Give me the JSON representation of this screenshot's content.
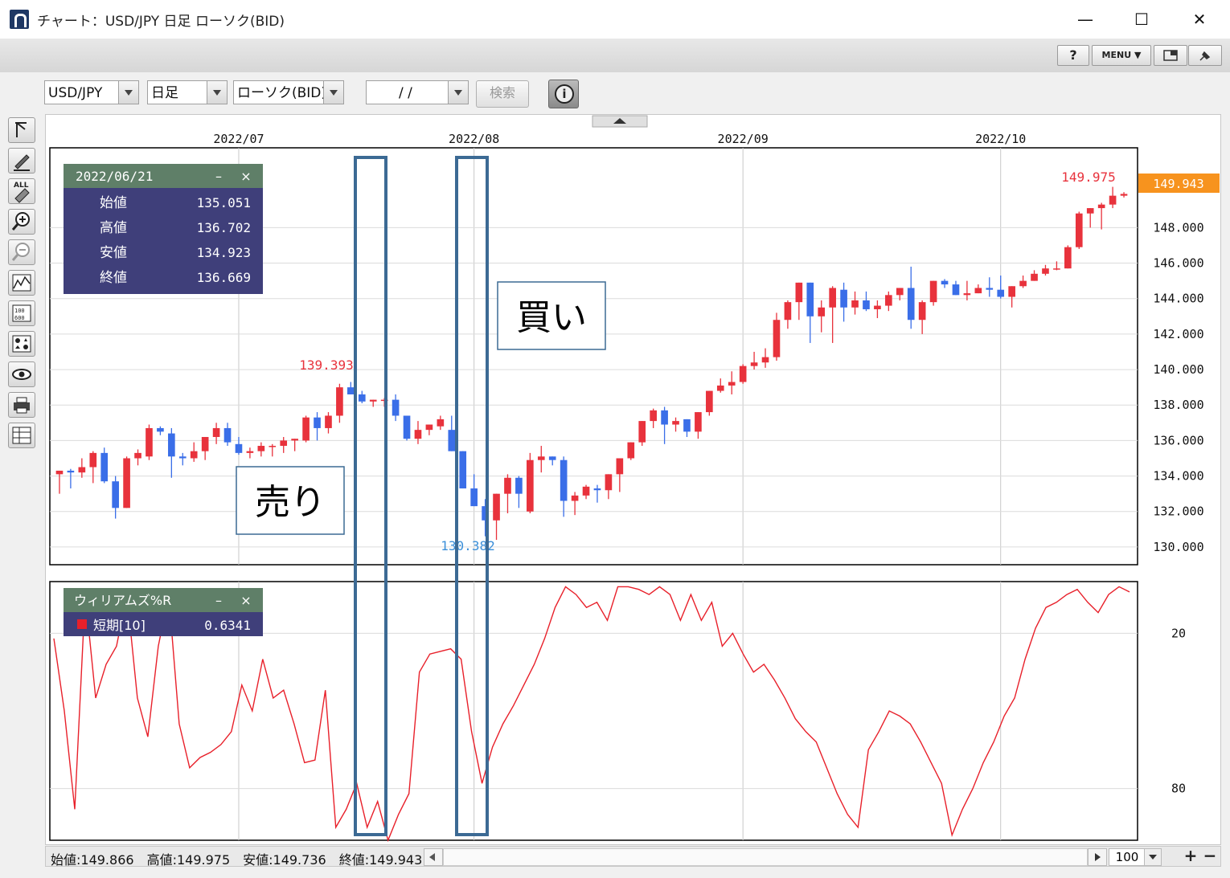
{
  "window": {
    "title": "チャート：USD/JPY 日足 ローソク(BID)",
    "minimize": "—",
    "maximize": "☐",
    "close": "✕"
  },
  "toolbar": {
    "help": "?",
    "menu": "MENU ▼",
    "layout_icon": "window-icon",
    "pin_icon": "pin-icon"
  },
  "controls": {
    "pair": "USD/JPY",
    "period": "日足",
    "chart_type": "ローソク(BID)",
    "date": "/ /",
    "search": "検索",
    "info_icon": "info-icon"
  },
  "sidebar_icons": [
    "cursor-icon",
    "pencil-icon",
    "eraser-all-icon",
    "zoom-in-icon",
    "zoom-out-icon",
    "indicator-icon",
    "numeric-icon",
    "symbols-icon",
    "eye-icon",
    "print-icon",
    "table-icon"
  ],
  "sidebar_all_label": "ALL",
  "chart_data": {
    "type": "candlestick",
    "title": "USD/JPY 日足 ローソク(BID)",
    "x_labels": [
      "2022/07",
      "2022/08",
      "2022/09",
      "2022/10"
    ],
    "y_ticks": [
      130,
      132,
      134,
      136,
      138,
      140,
      142,
      144,
      146,
      148
    ],
    "y_tick_labels": [
      "130.000",
      "132.000",
      "134.000",
      "136.000",
      "138.000",
      "140.000",
      "142.000",
      "144.000",
      "146.000",
      "148.000"
    ],
    "ylim": [
      129,
      152.5
    ],
    "current_price": "149.943",
    "high_label": "149.975",
    "peak_label": "139.393",
    "low_label": "130.382",
    "candles": [
      [
        134.1,
        134.2,
        133.0,
        134.3
      ],
      [
        134.3,
        134.4,
        133.3,
        134.2
      ],
      [
        134.2,
        135.0,
        133.9,
        134.5
      ],
      [
        134.5,
        135.4,
        133.6,
        135.3
      ],
      [
        135.3,
        135.6,
        133.6,
        133.7
      ],
      [
        133.7,
        134.0,
        131.6,
        132.2
      ],
      [
        132.2,
        135.1,
        132.3,
        135.0
      ],
      [
        135.0,
        135.5,
        134.6,
        135.3
      ],
      [
        135.1,
        136.9,
        134.9,
        136.7
      ],
      [
        136.7,
        136.8,
        136.3,
        136.5
      ],
      [
        136.4,
        136.7,
        133.9,
        135.1
      ],
      [
        135.1,
        135.3,
        134.6,
        135.0
      ],
      [
        135.0,
        135.9,
        134.8,
        135.4
      ],
      [
        135.4,
        136.1,
        134.9,
        136.2
      ],
      [
        136.2,
        137.0,
        135.8,
        136.7
      ],
      [
        136.7,
        137.0,
        135.7,
        135.9
      ],
      [
        135.8,
        136.2,
        135.2,
        135.3
      ],
      [
        135.3,
        135.6,
        135.0,
        135.4
      ],
      [
        135.4,
        135.9,
        135.1,
        135.7
      ],
      [
        135.7,
        135.8,
        135.1,
        135.7
      ],
      [
        135.7,
        136.2,
        135.3,
        136.0
      ],
      [
        136.0,
        136.1,
        135.4,
        136.1
      ],
      [
        136.0,
        137.4,
        135.9,
        137.3
      ],
      [
        137.3,
        137.6,
        136.0,
        136.7
      ],
      [
        136.7,
        137.6,
        136.4,
        137.4
      ],
      [
        137.4,
        139.2,
        137.0,
        139.0
      ],
      [
        139.0,
        139.3,
        138.7,
        138.6
      ],
      [
        138.6,
        138.8,
        138.1,
        138.2
      ],
      [
        138.2,
        138.2,
        137.9,
        138.3
      ],
      [
        138.3,
        138.4,
        137.9,
        138.3
      ],
      [
        138.3,
        138.6,
        137.1,
        137.4
      ],
      [
        137.4,
        137.4,
        136.0,
        136.1
      ],
      [
        136.1,
        137.1,
        135.8,
        136.6
      ],
      [
        136.6,
        136.9,
        136.3,
        136.9
      ],
      [
        136.8,
        137.4,
        136.6,
        137.2
      ],
      [
        136.6,
        137.4,
        135.5,
        135.4
      ],
      [
        135.4,
        134.5,
        133.5,
        133.3
      ],
      [
        133.3,
        134.1,
        132.6,
        132.3
      ],
      [
        132.3,
        132.7,
        130.6,
        131.5
      ],
      [
        131.5,
        132.3,
        130.4,
        133.0
      ],
      [
        133.0,
        134.1,
        131.9,
        133.9
      ],
      [
        133.9,
        134.0,
        132.2,
        133.0
      ],
      [
        132.0,
        135.3,
        131.9,
        134.9
      ],
      [
        134.9,
        135.7,
        134.2,
        135.1
      ],
      [
        135.1,
        135.1,
        134.6,
        134.9
      ],
      [
        134.9,
        135.1,
        131.7,
        132.6
      ],
      [
        132.6,
        133.1,
        131.8,
        132.9
      ],
      [
        132.9,
        133.5,
        132.7,
        133.4
      ],
      [
        133.3,
        133.5,
        132.5,
        133.2
      ],
      [
        133.2,
        134.0,
        132.7,
        134.1
      ],
      [
        134.1,
        135.0,
        133.1,
        135.0
      ],
      [
        135.0,
        135.7,
        134.9,
        135.9
      ],
      [
        135.9,
        137.0,
        135.7,
        137.1
      ],
      [
        137.1,
        137.8,
        136.7,
        137.7
      ],
      [
        137.7,
        137.9,
        135.8,
        136.9
      ],
      [
        136.9,
        137.3,
        136.5,
        137.1
      ],
      [
        137.2,
        137.1,
        136.2,
        136.5
      ],
      [
        136.5,
        137.6,
        136.1,
        137.6
      ],
      [
        137.6,
        138.8,
        137.4,
        138.8
      ],
      [
        138.8,
        139.5,
        138.7,
        139.1
      ],
      [
        139.1,
        139.9,
        138.6,
        139.3
      ],
      [
        139.3,
        140.3,
        139.2,
        140.2
      ],
      [
        140.2,
        141.0,
        140.0,
        140.4
      ],
      [
        140.4,
        141.2,
        140.1,
        140.7
      ],
      [
        140.7,
        143.2,
        140.5,
        142.8
      ],
      [
        142.8,
        143.9,
        142.3,
        143.8
      ],
      [
        143.8,
        144.9,
        142.8,
        144.9
      ],
      [
        144.9,
        144.9,
        141.5,
        143.0
      ],
      [
        143.0,
        143.9,
        142.1,
        143.5
      ],
      [
        143.5,
        144.7,
        141.5,
        144.6
      ],
      [
        144.5,
        144.9,
        142.7,
        143.5
      ],
      [
        143.5,
        144.4,
        143.1,
        143.9
      ],
      [
        143.9,
        144.4,
        143.3,
        143.4
      ],
      [
        143.4,
        143.9,
        142.9,
        143.6
      ],
      [
        143.6,
        144.4,
        143.3,
        144.2
      ],
      [
        144.2,
        144.6,
        143.9,
        144.6
      ],
      [
        144.6,
        145.8,
        142.3,
        142.8
      ],
      [
        142.8,
        143.9,
        142.0,
        143.8
      ],
      [
        143.8,
        144.8,
        143.6,
        145.0
      ],
      [
        145.0,
        145.1,
        144.6,
        144.8
      ],
      [
        144.8,
        145.0,
        144.2,
        144.2
      ],
      [
        144.2,
        145.0,
        143.9,
        144.3
      ],
      [
        144.3,
        144.8,
        144.3,
        144.6
      ],
      [
        144.6,
        145.2,
        144.1,
        144.5
      ],
      [
        144.5,
        145.3,
        144.0,
        144.1
      ],
      [
        144.1,
        144.7,
        143.5,
        144.7
      ],
      [
        144.7,
        145.3,
        144.6,
        145.0
      ],
      [
        145.0,
        145.6,
        145.0,
        145.4
      ],
      [
        145.4,
        145.9,
        145.3,
        145.7
      ],
      [
        145.7,
        146.1,
        145.6,
        145.7
      ],
      [
        145.7,
        147.0,
        145.7,
        146.9
      ],
      [
        146.9,
        148.9,
        146.8,
        148.8
      ],
      [
        148.8,
        149.1,
        148.0,
        149.1
      ],
      [
        149.1,
        149.4,
        147.9,
        149.3
      ],
      [
        149.3,
        150.3,
        149.1,
        149.8
      ],
      [
        149.8,
        150.0,
        149.7,
        149.9
      ]
    ],
    "williams_r": [
      -22,
      -50,
      -88,
      -5,
      -45,
      -32,
      -25,
      -5,
      -45,
      -60,
      -25,
      -5,
      -55,
      -72,
      -68,
      -66,
      -63,
      -58,
      -40,
      -50,
      -30,
      -45,
      -42,
      -55,
      -70,
      -69,
      -42,
      -95,
      -88,
      -78,
      -95,
      -85,
      -100,
      -90,
      -82,
      -35,
      -28,
      -27,
      -26,
      -30,
      -58,
      -78,
      -64,
      -55,
      -48,
      -40,
      -32,
      -22,
      -10,
      -2,
      -5,
      -10,
      -8,
      -15,
      -2,
      -2,
      -3,
      -5,
      -2,
      -5,
      -15,
      -5,
      -15,
      -8,
      -25,
      -20,
      -28,
      -35,
      -32,
      -38,
      -45,
      -53,
      -58,
      -62,
      -72,
      -82,
      -90,
      -95,
      -65,
      -58,
      -50,
      -52,
      -55,
      -62,
      -70,
      -78,
      -98,
      -88,
      -80,
      -70,
      -62,
      -52,
      -45,
      -30,
      -18,
      -10,
      -8,
      -5,
      -3,
      -8,
      -12,
      -5,
      -2,
      -4
    ],
    "williams_y_labels": [
      "20",
      "80"
    ]
  },
  "info_panel": {
    "date": "2022/06/21",
    "rows": [
      {
        "label": "始値",
        "value": "135.051"
      },
      {
        "label": "高値",
        "value": "136.702"
      },
      {
        "label": "安値",
        "value": "134.923"
      },
      {
        "label": "終値",
        "value": "136.669"
      }
    ],
    "min": "–",
    "close": "×"
  },
  "indicator_panel": {
    "title": "ウィリアムズ%R",
    "series": "短期[10]",
    "value": "0.6341",
    "series_color": "#e8202a",
    "min": "–",
    "close": "×"
  },
  "annotations": {
    "sell": "売り",
    "buy": "買い"
  },
  "status": {
    "open": "始値:149.866",
    "high": "高値:149.975",
    "low": "安値:149.736",
    "close": "終値:149.943",
    "zoom": "100",
    "plus": "+",
    "minus": "−"
  },
  "colors": {
    "up": "#e8323c",
    "down": "#3a6ee8",
    "price_tag": "#f7931e",
    "panel_bg": "#3f3f7a",
    "panel_header": "#5f7f68",
    "annot_border": "#3c6a94"
  }
}
